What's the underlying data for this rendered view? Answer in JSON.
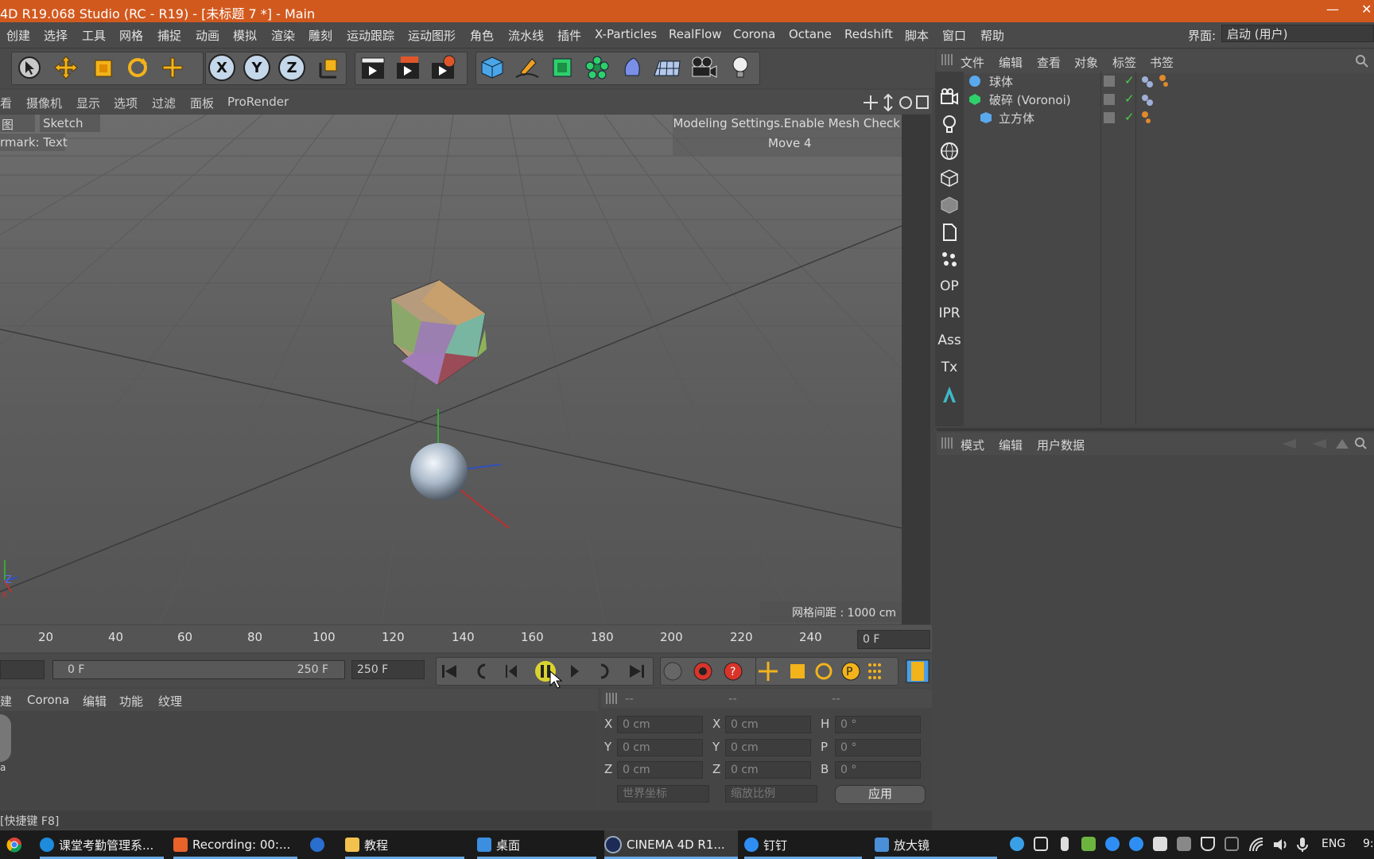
{
  "window": {
    "title": "4D R19.068 Studio (RC - R19) - [未标题 7 *] - Main",
    "minimize": "—",
    "close": "✕"
  },
  "menubar": {
    "items": [
      "创建",
      "选择",
      "工具",
      "网格",
      "捕捉",
      "动画",
      "模拟",
      "渲染",
      "雕刻",
      "运动跟踪",
      "运动图形",
      "角色",
      "流水线",
      "插件",
      "X-Particles",
      "RealFlow",
      "Corona",
      "Octane",
      "Redshift",
      "脚本",
      "窗口",
      "帮助"
    ],
    "layout_label": "界面:",
    "layout_value": "启动 (用户)"
  },
  "viewport_menu": {
    "items": [
      "看",
      "摄像机",
      "显示",
      "选项",
      "过滤",
      "面板",
      "ProRender"
    ]
  },
  "viewport": {
    "tab_left": "图",
    "tab_sketch": "Sketch",
    "watermark": "rmark: Text",
    "hud_line1": "Modeling Settings.Enable Mesh Check",
    "hud_line2": "Move 4",
    "grid_spacing": "网格间距 : 1000 cm",
    "axis_z": "Z",
    "axis_x": "x"
  },
  "object_manager": {
    "menu": [
      "文件",
      "编辑",
      "查看",
      "对象",
      "标签",
      "书签"
    ],
    "objects": [
      {
        "name": "球体"
      },
      {
        "name": "破碎 (Voronoi)"
      },
      {
        "name": "立方体"
      }
    ]
  },
  "attribute_manager": {
    "menu": [
      "模式",
      "编辑",
      "用户数据"
    ]
  },
  "sidebar": {
    "labels": [
      "OP",
      "IPR",
      "Ass",
      "Tx"
    ]
  },
  "timeline": {
    "ticks": [
      "20",
      "40",
      "60",
      "80",
      "100",
      "120",
      "140",
      "160",
      "180",
      "200",
      "220",
      "240"
    ],
    "current_frame": "0 F"
  },
  "playback": {
    "range_start": "0 F",
    "range_end": "250 F",
    "end_frame": "250 F"
  },
  "material_manager": {
    "menu": [
      "建",
      "Corona",
      "编辑",
      "功能",
      "纹理"
    ],
    "thumb_label": "a"
  },
  "coordinates": {
    "header": [
      "--",
      "--",
      "--"
    ],
    "rows": [
      {
        "l1": "X",
        "v1": "0 cm",
        "l2": "X",
        "v2": "0 cm",
        "l3": "H",
        "v3": "0 °"
      },
      {
        "l1": "Y",
        "v1": "0 cm",
        "l2": "Y",
        "v2": "0 cm",
        "l3": "P",
        "v3": "0 °"
      },
      {
        "l1": "Z",
        "v1": "0 cm",
        "l2": "Z",
        "v2": "0 cm",
        "l3": "B",
        "v3": "0 °"
      }
    ],
    "world": "世界坐标",
    "scale": "缩放比例",
    "apply": "应用"
  },
  "status": {
    "text": "[快捷键 F8]"
  },
  "taskbar": {
    "items": [
      "课堂考勤管理系...",
      "Recording:  00:...",
      "",
      "教程",
      "桌面",
      "CINEMA 4D R1...",
      "钉钉",
      "放大镜"
    ],
    "lang": "ENG",
    "time": "9:"
  }
}
